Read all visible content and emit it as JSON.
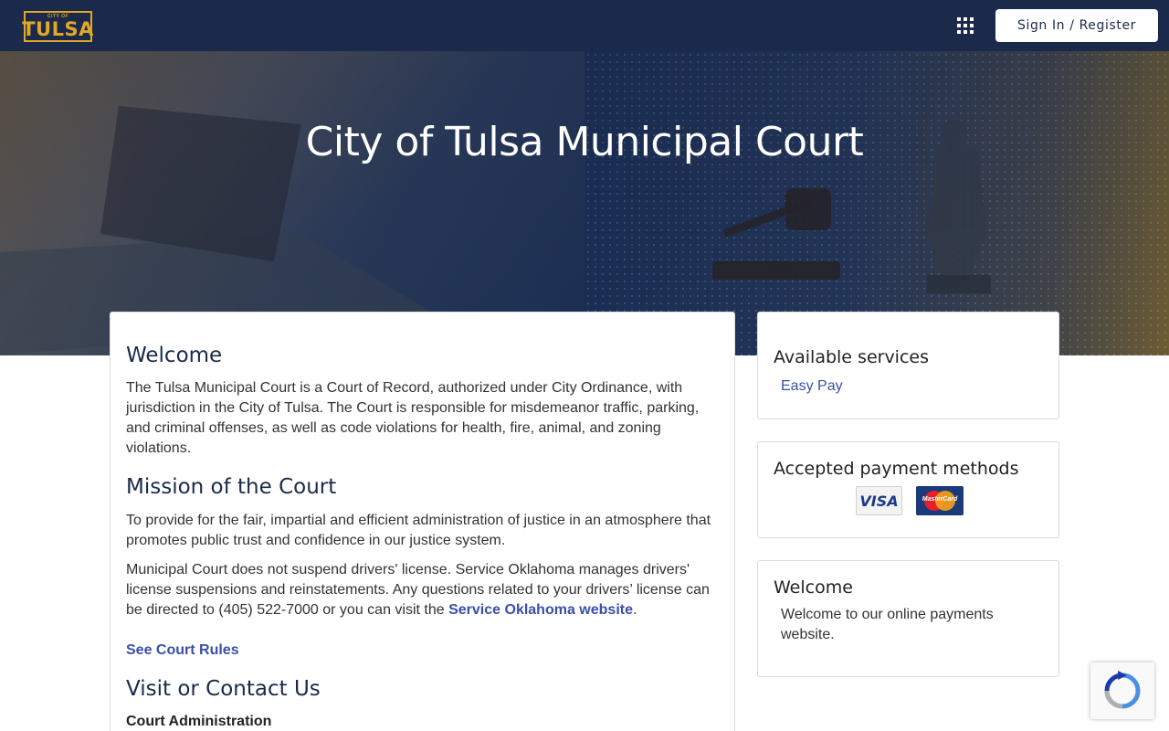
{
  "header": {
    "logo_small": "CITY OF",
    "logo_big": "TULSA",
    "signin_label": "Sign In / Register",
    "apps_icon": "grid-apps-icon"
  },
  "hero": {
    "title": "City of Tulsa Municipal Court"
  },
  "main": {
    "welcome_heading": "Welcome",
    "welcome_text": "The Tulsa Municipal Court is a Court of Record, authorized under City Ordinance, with jurisdiction in the City of Tulsa. The Court is responsible for misdemeanor traffic, parking, and criminal offenses, as well as code violations for health, fire, animal, and zoning violations.",
    "mission_heading": "Mission of the Court",
    "mission_text": "To provide for the fair, impartial and efficient administration of justice in an atmosphere that promotes public trust and confidence in our justice system.",
    "license_text": "Municipal Court does not suspend drivers' license. Service Oklahoma manages drivers' license suspensions and reinstatements. Any questions related to your drivers’ license can be directed to (405) 522-7000 or you can visit the ",
    "license_link": "Service Oklahoma website",
    "license_end": ".",
    "court_rules_link": "See Court Rules",
    "contact_heading": "Visit or Contact Us",
    "court_admin": "Court Administration"
  },
  "sidebar": {
    "services_title": "Available services",
    "services": [
      "Easy Pay"
    ],
    "payment_title": "Accepted payment methods",
    "payment_methods": [
      "VISA",
      "MasterCard"
    ],
    "welcome_title": "Welcome",
    "welcome_text": "Welcome to our online payments website."
  },
  "colors": {
    "navbar": "#1b2a4a",
    "accent_gold": "#e0a826",
    "link": "#3a4fa8"
  }
}
